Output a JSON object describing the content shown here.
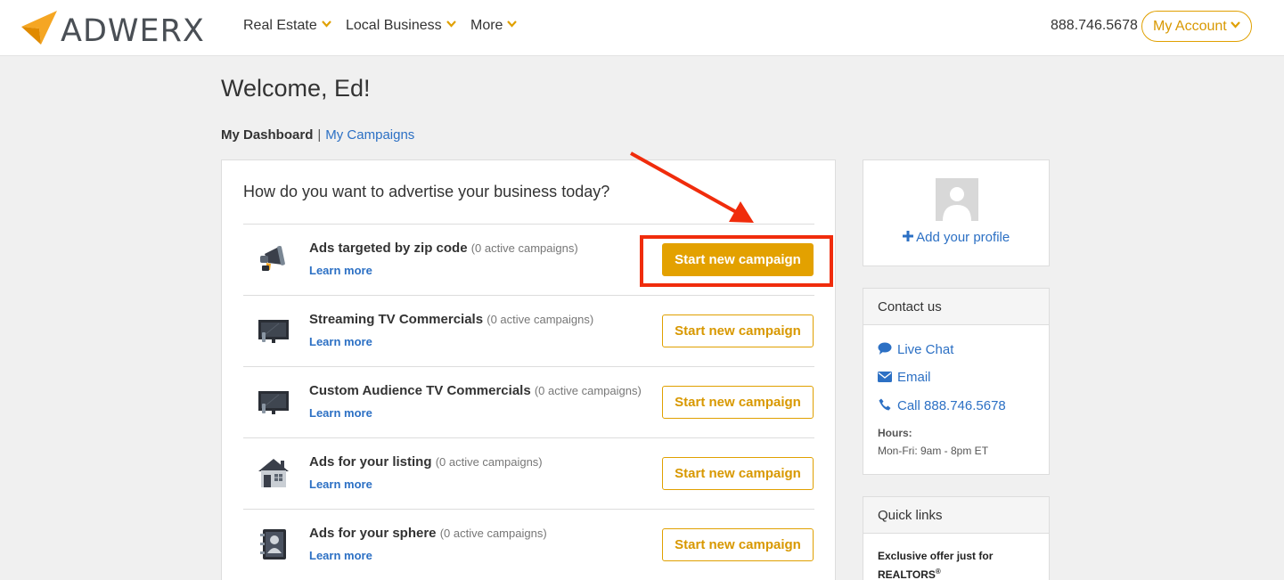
{
  "header": {
    "logo_text": "ADWERX",
    "nav": [
      {
        "label": "Real Estate"
      },
      {
        "label": "Local Business"
      },
      {
        "label": "More"
      }
    ],
    "phone": "888.746.5678",
    "account_label": "My Account"
  },
  "welcome": "Welcome, Ed!",
  "breadcrumb": {
    "current": "My Dashboard",
    "separator": "|",
    "link": "My Campaigns"
  },
  "main": {
    "question": "How do you want to advertise your business today?",
    "rows": [
      {
        "title": "Ads targeted by zip code",
        "sub": "(0 active campaigns)",
        "learn": "Learn more",
        "button": "Start new campaign",
        "icon": "megaphone-icon"
      },
      {
        "title": "Streaming TV Commercials",
        "sub": "(0 active campaigns)",
        "learn": "Learn more",
        "button": "Start new campaign",
        "icon": "tv-icon"
      },
      {
        "title": "Custom Audience TV Commercials",
        "sub": "(0 active campaigns)",
        "learn": "Learn more",
        "button": "Start new campaign",
        "icon": "tv-icon"
      },
      {
        "title": "Ads for your listing",
        "sub": "(0 active campaigns)",
        "learn": "Learn more",
        "button": "Start new campaign",
        "icon": "house-icon"
      },
      {
        "title": "Ads for your sphere",
        "sub": "(0 active campaigns)",
        "learn": "Learn more",
        "button": "Start new campaign",
        "icon": "contact-book-icon"
      }
    ]
  },
  "profile": {
    "add_label": "Add your profile"
  },
  "contact": {
    "heading": "Contact us",
    "items": [
      {
        "label": "Live Chat",
        "icon": "chat-icon"
      },
      {
        "label": "Email",
        "icon": "envelope-icon"
      },
      {
        "label": "Call 888.746.5678",
        "icon": "phone-icon"
      }
    ],
    "hours_label": "Hours:",
    "hours_value": "Mon-Fri: 9am - 8pm ET"
  },
  "quick_links": {
    "heading": "Quick links",
    "offer_text": "Exclusive offer just for REALTORS",
    "offer_mark": "®"
  },
  "colors": {
    "accent": "#e3a100",
    "link": "#2c70c4",
    "annotation": "#f02c0c"
  }
}
